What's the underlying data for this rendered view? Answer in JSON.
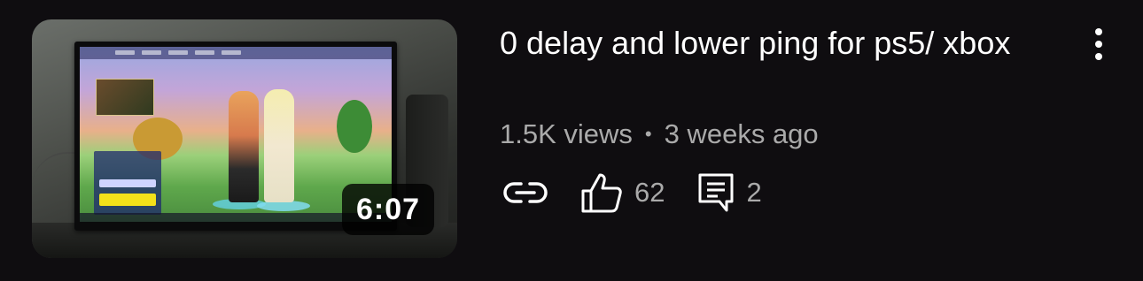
{
  "video": {
    "duration": "6:07",
    "title": "0 delay and lower ping for ps5/ xbox",
    "views": "1.5K views",
    "separator": "•",
    "age": "3 weeks ago"
  },
  "actions": {
    "share_icon": "link-icon",
    "like_icon": "thumbs-up-icon",
    "likes": "62",
    "comment_icon": "comment-icon",
    "comments": "2",
    "more_icon": "more-vertical-icon"
  },
  "colors": {
    "background": "#0f0d10",
    "primary_text": "#ffffff",
    "secondary_text": "#aaaaaa"
  }
}
